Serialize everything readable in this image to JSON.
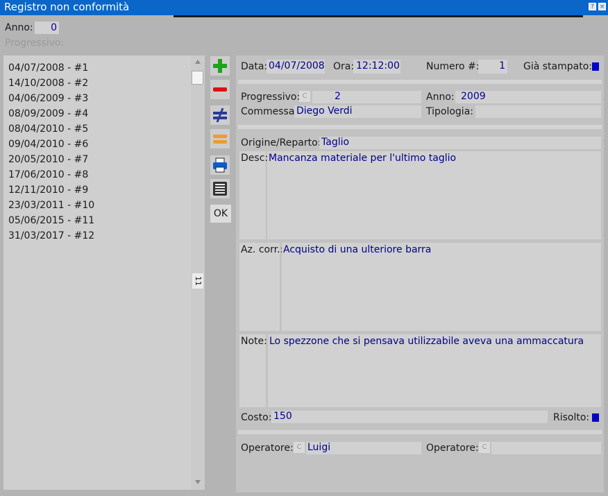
{
  "window": {
    "title": "Registro non conformità",
    "help_label": "?",
    "close_label": "×"
  },
  "header": {
    "anno_label": "Anno:",
    "anno_value": "0",
    "progressivo_label": "Progressivo:"
  },
  "list": {
    "items": [
      "04/07/2008 - #1",
      "14/10/2008 - #2",
      "04/06/2009 - #3",
      "08/09/2009 - #4",
      "08/04/2010 - #5",
      "09/04/2010 - #6",
      "20/05/2010 - #7",
      "17/06/2010 - #8",
      "12/11/2010 - #9",
      "23/03/2011 - #10",
      "05/06/2015 - #11",
      "31/03/2017 - #12"
    ],
    "scroll_count": "11"
  },
  "toolbar": {
    "icons": [
      "add-icon",
      "remove-icon",
      "not-equal-icon",
      "equal-icon",
      "printer-icon",
      "list-icon"
    ],
    "ok_label": "OK"
  },
  "detail": {
    "data_label": "Data:",
    "data_value": "04/07/2008",
    "ora_label": "Ora:",
    "ora_value": "12:12:00",
    "numero_label": "Numero #:",
    "numero_value": "1",
    "stampato_label": "Già stampato:",
    "progressivo_label": "Progressivo:",
    "progressivo_value": "2",
    "anno_label": "Anno:",
    "anno_value": "2009",
    "commessa_label": "Commessa:",
    "commessa_value": "Diego Verdi",
    "tipologia_label": "Tipologia:",
    "tipologia_value": "",
    "origine_label": "Origine/Reparto:",
    "origine_value": "Taglio",
    "desc_label": "Desc:",
    "desc_value": "Mancanza materiale per l'ultimo taglio",
    "azcorr_label": "Az. corr.:",
    "azcorr_value": "Acquisto di una ulteriore barra",
    "note_label": "Note:",
    "note_value": "Lo spezzone che si pensava utilizzabile aveva una ammaccatura",
    "costo_label": "Costo:",
    "costo_value": "150",
    "risolto_label": "Risolto:",
    "operatore1_label": "Operatore:",
    "operatore1_value": "Luigi",
    "operatore2_label": "Operatore:",
    "operatore2_value": "",
    "c_button": "C"
  },
  "colors": {
    "title_bar": "#0a66c9",
    "value_text": "#00008b",
    "checkbox_on": "#0000c8"
  }
}
